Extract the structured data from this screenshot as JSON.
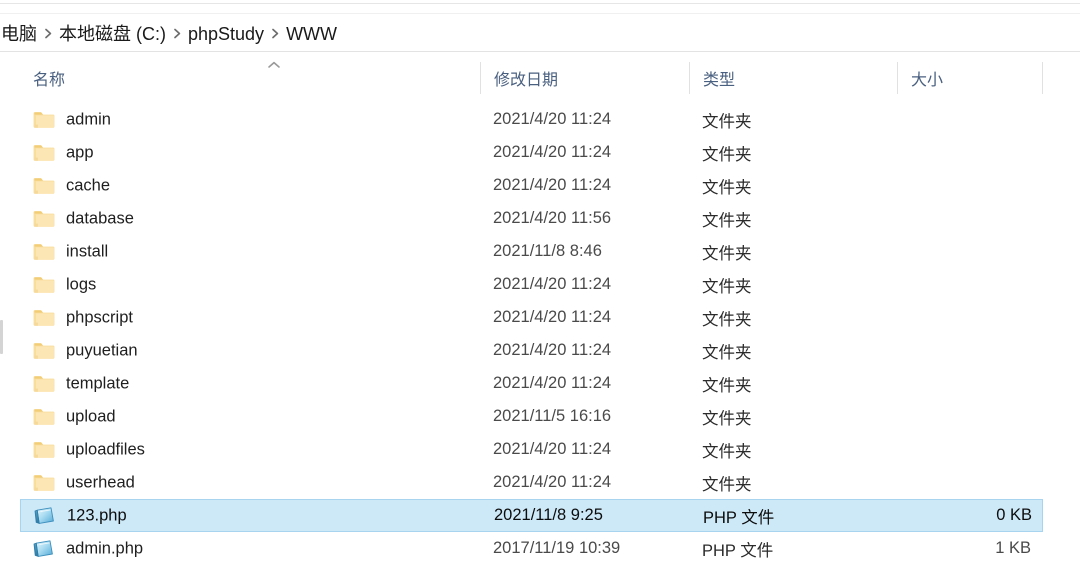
{
  "window": {
    "app": "Windows File Explorer"
  },
  "breadcrumb": {
    "separator_icon": "chevron-right-icon",
    "items": [
      {
        "label": "电脑"
      },
      {
        "label": "本地磁盘 (C:)"
      },
      {
        "label": "phpStudy"
      },
      {
        "label": "WWW"
      }
    ]
  },
  "columns": {
    "sort_indicator_icon": "chevron-up-icon",
    "sorted_by": "名称",
    "sort_direction": "ascending",
    "headers": [
      {
        "key": "name",
        "label": "名称"
      },
      {
        "key": "date",
        "label": "修改日期"
      },
      {
        "key": "type",
        "label": "类型"
      },
      {
        "key": "size",
        "label": "大小"
      }
    ]
  },
  "colors": {
    "selection_fill": "#cde8f7",
    "selection_border": "#a9d4ef",
    "header_text": "#4a6080",
    "folder_icon": "#f6d186",
    "php_icon": "#5bb8e0"
  },
  "files": [
    {
      "name": "admin",
      "icon": "folder-icon",
      "date": "2021/4/20 11:24",
      "type": "文件夹",
      "size": "",
      "selected": false
    },
    {
      "name": "app",
      "icon": "folder-icon",
      "date": "2021/4/20 11:24",
      "type": "文件夹",
      "size": "",
      "selected": false
    },
    {
      "name": "cache",
      "icon": "folder-icon",
      "date": "2021/4/20 11:24",
      "type": "文件夹",
      "size": "",
      "selected": false
    },
    {
      "name": "database",
      "icon": "folder-icon",
      "date": "2021/4/20 11:56",
      "type": "文件夹",
      "size": "",
      "selected": false
    },
    {
      "name": "install",
      "icon": "folder-icon",
      "date": "2021/11/8 8:46",
      "type": "文件夹",
      "size": "",
      "selected": false
    },
    {
      "name": "logs",
      "icon": "folder-icon",
      "date": "2021/4/20 11:24",
      "type": "文件夹",
      "size": "",
      "selected": false
    },
    {
      "name": "phpscript",
      "icon": "folder-icon",
      "date": "2021/4/20 11:24",
      "type": "文件夹",
      "size": "",
      "selected": false
    },
    {
      "name": "puyuetian",
      "icon": "folder-icon",
      "date": "2021/4/20 11:24",
      "type": "文件夹",
      "size": "",
      "selected": false
    },
    {
      "name": "template",
      "icon": "folder-icon",
      "date": "2021/4/20 11:24",
      "type": "文件夹",
      "size": "",
      "selected": false
    },
    {
      "name": "upload",
      "icon": "folder-icon",
      "date": "2021/11/5 16:16",
      "type": "文件夹",
      "size": "",
      "selected": false
    },
    {
      "name": "uploadfiles",
      "icon": "folder-icon",
      "date": "2021/4/20 11:24",
      "type": "文件夹",
      "size": "",
      "selected": false
    },
    {
      "name": "userhead",
      "icon": "folder-icon",
      "date": "2021/4/20 11:24",
      "type": "文件夹",
      "size": "",
      "selected": false
    },
    {
      "name": "123.php",
      "icon": "php-file-icon",
      "date": "2021/11/8 9:25",
      "type": "PHP 文件",
      "size": "0 KB",
      "selected": true
    },
    {
      "name": "admin.php",
      "icon": "php-file-icon",
      "date": "2017/11/19 10:39",
      "type": "PHP 文件",
      "size": "1 KB",
      "selected": false
    }
  ]
}
